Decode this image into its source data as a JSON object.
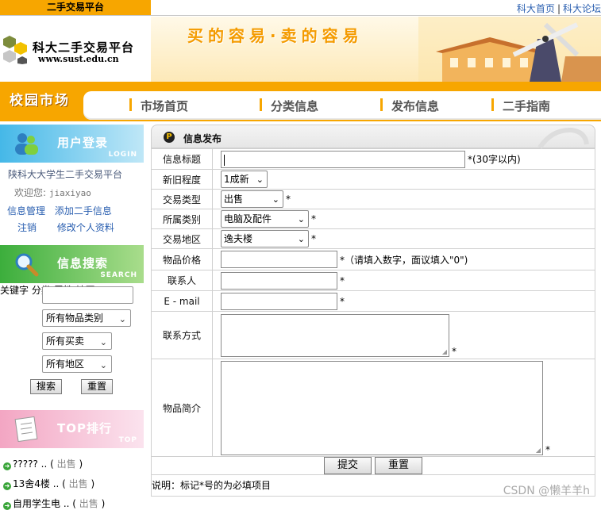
{
  "topbar": {
    "tag": "二手交易平台",
    "links": [
      "科大首页",
      "科大论坛"
    ],
    "separator": "|"
  },
  "header": {
    "site_name": "科大二手交易平台",
    "site_url": "www.sust.edu.cn",
    "slogan": "买的容易·卖的容易"
  },
  "nav": {
    "title": "校园市场",
    "items": [
      "市场首页",
      "分类信息",
      "发布信息",
      "二手指南"
    ]
  },
  "sidebar": {
    "login": {
      "title": "用户登录",
      "subtitle": "LOGIN",
      "school": "陕科大大学生二手交易平台",
      "welcome": "欢迎您:",
      "username": "jiaxiyao",
      "links": [
        "信息管理",
        "添加二手信息"
      ],
      "links2": [
        "注销",
        "修改个人资料"
      ]
    },
    "search": {
      "title": "信息搜索",
      "subtitle": "SEARCH",
      "keyword_label": "关键字",
      "keyword_value": "",
      "category_label": "分类",
      "category_value": "所有物品类别",
      "attr_label": "属性",
      "attr_value": "所有买卖",
      "region_label": "地区",
      "region_value": "所有地区",
      "search_button": "搜索",
      "reset_button": "重置"
    },
    "top": {
      "title": "TOP排行",
      "subtitle": "TOP",
      "items": [
        {
          "name": "????? ..",
          "status": "出售"
        },
        {
          "name": "13舍4楼 ..",
          "status": "出售"
        },
        {
          "name": "自用学生电 ..",
          "status": "出售"
        }
      ]
    }
  },
  "main": {
    "header_title": "信息发布",
    "header_icon": "P",
    "fields": {
      "title_label": "信息标题",
      "title_hint": "*(30字以内)",
      "condition_label": "新旧程度",
      "condition_value": "1成新",
      "type_label": "交易类型",
      "type_value": "出售",
      "category_label": "所属类别",
      "category_value": "电脑及配件",
      "region_label": "交易地区",
      "region_value": "逸夫楼",
      "price_label": "物品价格",
      "price_hint": "*（请填入数字，面议填入\"0\")",
      "contact_label": "联系人",
      "email_label": "E - mail",
      "method_label": "联系方式",
      "desc_label": "物品简介",
      "required_mark": "*"
    },
    "submit_button": "提交",
    "reset_button": "重置",
    "note": "说明：标记*号的为必填项目"
  },
  "watermark": "CSDN @懒羊羊h"
}
